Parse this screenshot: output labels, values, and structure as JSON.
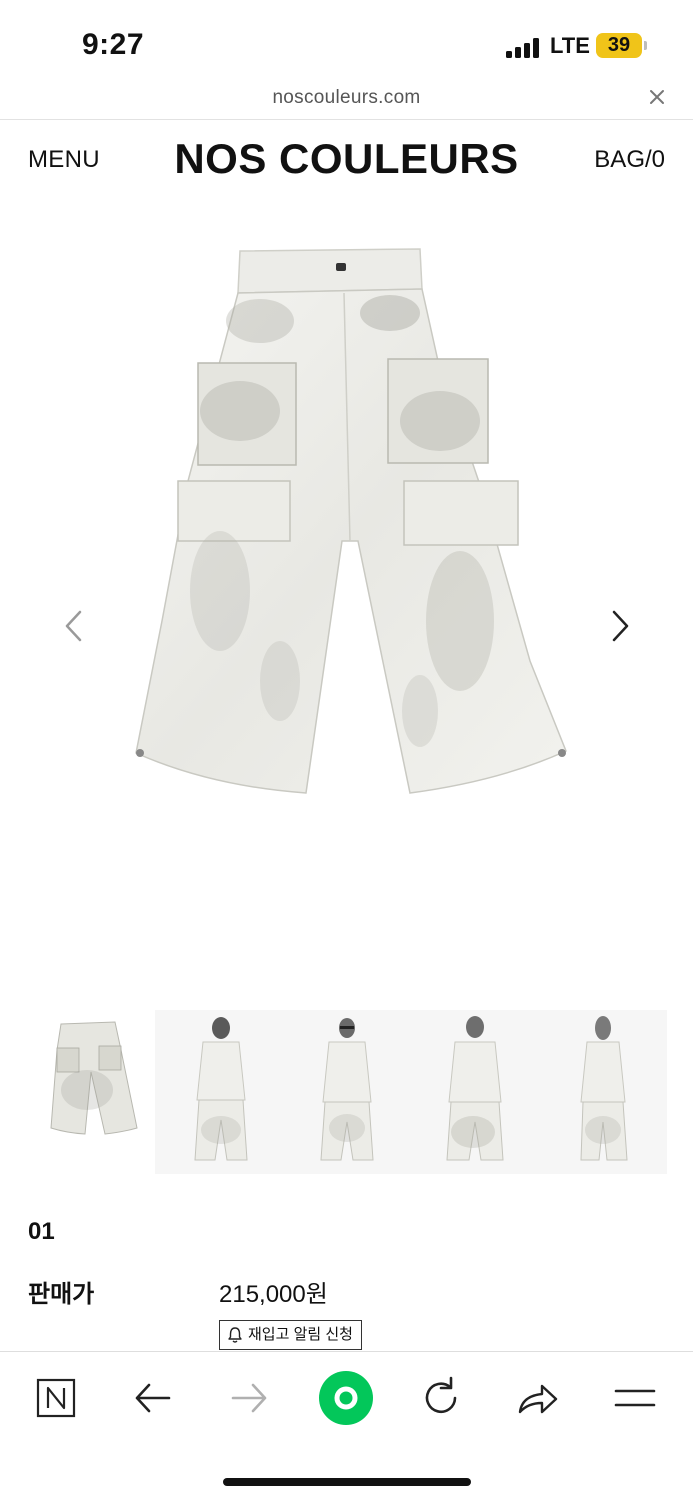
{
  "status_bar": {
    "time": "9:27",
    "network": "LTE",
    "battery": "39",
    "battery_color": "#f0c419"
  },
  "browser": {
    "url": "noscouleurs.com",
    "close_icon": "close-icon"
  },
  "header": {
    "menu_label": "MENU",
    "logo": "NOS COULEURS",
    "bag_label": "BAG/0"
  },
  "gallery": {
    "main_image": "white-painted-cargo-pants",
    "prev_icon": "chevron-left-icon",
    "next_icon": "chevron-right-icon",
    "thumbnails": [
      "pants-flat-lay",
      "model-front-view",
      "model-front-view-sunglasses",
      "model-back-view",
      "model-side-view"
    ]
  },
  "product": {
    "name": "01",
    "price_label": "판매가",
    "price": "215,000원",
    "restock_label": "재입고 알림 신청"
  },
  "bottom_toolbar": {
    "items": [
      "naver-icon",
      "back-arrow-icon",
      "forward-arrow-icon",
      "green-circle-icon",
      "refresh-icon",
      "share-icon",
      "menu-icon"
    ],
    "accent_color": "#03c75a"
  }
}
